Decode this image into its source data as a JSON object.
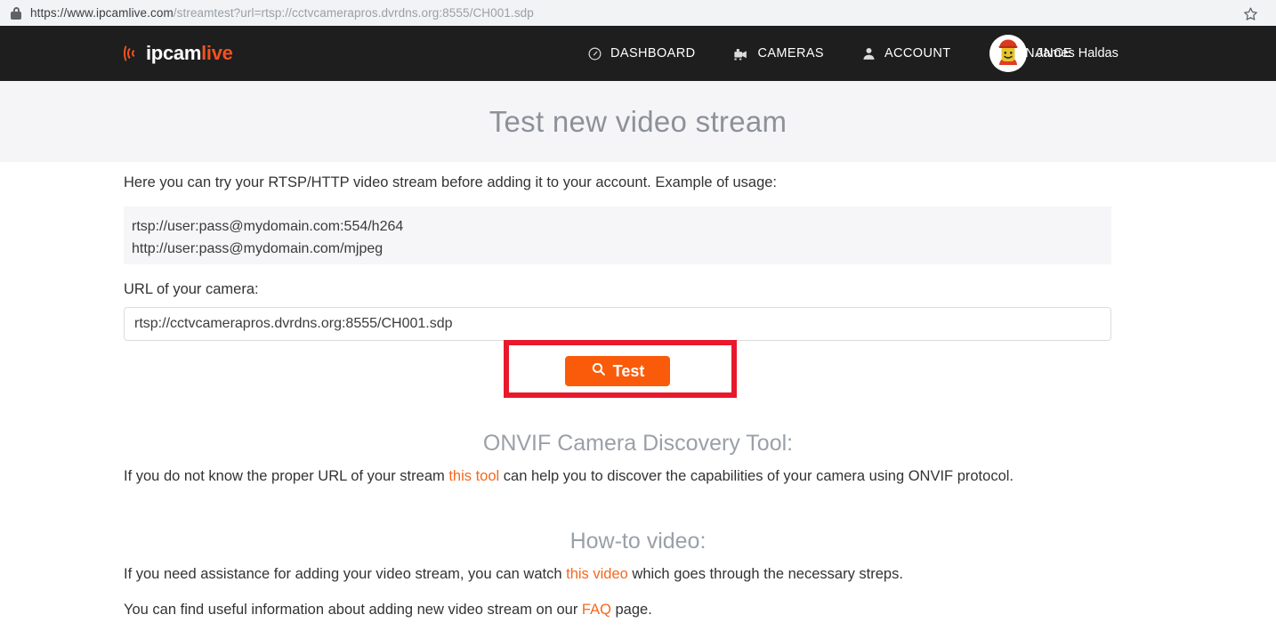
{
  "browser": {
    "url_protocol": "https://www.ipcamlive.com",
    "url_path": "/streamtest?url=rtsp://cctvcamerapros.dvrdns.org:8555/CH001.sdp",
    "url_full": "https://www.ipcamlive.com/streamtest?url=rtsp://cctvcamerapros.dvrdns.org:8555/CH001.sdp",
    "lock_icon": "lock-icon",
    "bookmark_icon": "star-icon"
  },
  "navbar": {
    "logo_primary": "ipcam",
    "logo_accent": "live",
    "items": [
      {
        "label": "DASHBOARD",
        "icon": "dashboard-gauge-icon"
      },
      {
        "label": "CAMERAS",
        "icon": "camera-icon"
      },
      {
        "label": "ACCOUNT",
        "icon": "person-icon"
      },
      {
        "label": "FINANCE",
        "icon": "bars-icon"
      }
    ],
    "user_name": "James Haldas",
    "avatar_icon": "avatar"
  },
  "header": {
    "title": "Test new video stream"
  },
  "main": {
    "intro": "Here you can try your RTSP/HTTP video stream before adding it to your account. Example of usage:",
    "examples": [
      "rtsp://user:pass@mydomain.com:554/h264",
      "http://user:pass@mydomain.com/mjpeg"
    ],
    "url_label": "URL of your camera:",
    "url_value": "rtsp://cctvcamerapros.dvrdns.org:8555/CH001.sdp",
    "url_placeholder": "rtsp://user:pass@mydomain.com:554/h264",
    "test_button": {
      "label": "Test",
      "icon": "search-icon",
      "color": "#fa5b0a"
    },
    "annotation": {
      "color": "#e8192c",
      "target": "test-button"
    },
    "onvif": {
      "title": "ONVIF Camera Discovery Tool:",
      "text_before": "If you do not know the proper URL of your stream ",
      "link": "this tool",
      "text_after": " can help you to discover the capabilities of your camera using ONVIF protocol."
    },
    "howto": {
      "title": "How-to video:",
      "line1_before": "If you need assistance for adding your video stream, you can watch ",
      "line1_link": "this video",
      "line1_after": " which goes through the necessary streps.",
      "line2_before": "You can find useful information about adding new video stream on our ",
      "line2_link": "FAQ",
      "line2_after": " page."
    }
  }
}
